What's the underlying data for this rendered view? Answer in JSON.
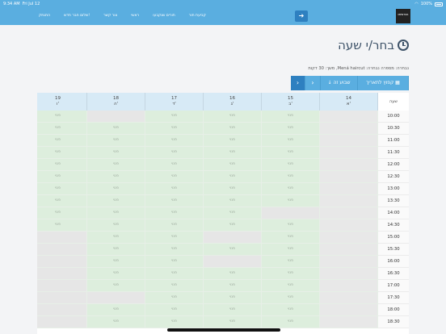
{
  "status": {
    "time": "9:34 AM",
    "date": "Fri Jul 12",
    "battery": "100%"
  },
  "nav": {
    "links": [
      "התנתק",
      "שלום חבר חדש!",
      "צור קשר",
      "ראשי",
      "תורים שנקבעו",
      "קביעת תור"
    ]
  },
  "logo": {
    "text": "MENTOR"
  },
  "page": {
    "title": "בחר/י שעה"
  },
  "selection": {
    "text": "נבחרה: מספרה נבחרה: Mená haircut, משך: 30 דקות"
  },
  "week_controls": {
    "jump_label": "קפוץ לתאריך",
    "this_week_label": "שבוע זה",
    "next_arrow": "›",
    "prev_arrow": "›"
  },
  "schedule": {
    "hour_header": "שעה",
    "free_label": "פנוי",
    "days": [
      {
        "num": "14",
        "abbr": "א'"
      },
      {
        "num": "15",
        "abbr": "ב'"
      },
      {
        "num": "16",
        "abbr": "ג'"
      },
      {
        "num": "17",
        "abbr": "ד'"
      },
      {
        "num": "18",
        "abbr": "ה'"
      },
      {
        "num": "19",
        "abbr": "ו'"
      }
    ],
    "hours": [
      "10:00",
      "10:30",
      "11:00",
      "11:30",
      "12:00",
      "12:30",
      "13:00",
      "13:30",
      "14:00",
      "14:30",
      "15:00",
      "15:30",
      "16:00",
      "16:30",
      "17:00",
      "17:30",
      "18:00",
      "18:30"
    ],
    "status": [
      [
        "c",
        "f",
        "f",
        "f",
        "b",
        "f"
      ],
      [
        "c",
        "f",
        "f",
        "f",
        "f",
        "f"
      ],
      [
        "c",
        "f",
        "f",
        "f",
        "f",
        "f"
      ],
      [
        "c",
        "f",
        "f",
        "f",
        "f",
        "f"
      ],
      [
        "c",
        "f",
        "f",
        "f",
        "f",
        "f"
      ],
      [
        "c",
        "f",
        "f",
        "f",
        "f",
        "f"
      ],
      [
        "c",
        "f",
        "f",
        "f",
        "f",
        "f"
      ],
      [
        "c",
        "f",
        "f",
        "f",
        "f",
        "f"
      ],
      [
        "c",
        "b",
        "f",
        "f",
        "f",
        "f"
      ],
      [
        "c",
        "f",
        "f",
        "f",
        "f",
        "f"
      ],
      [
        "c",
        "f",
        "b",
        "f",
        "f",
        "b"
      ],
      [
        "c",
        "f",
        "f",
        "f",
        "f",
        "b"
      ],
      [
        "c",
        "f",
        "b",
        "f",
        "f",
        "b"
      ],
      [
        "c",
        "f",
        "f",
        "f",
        "f",
        "b"
      ],
      [
        "c",
        "f",
        "f",
        "f",
        "f",
        "b"
      ],
      [
        "c",
        "f",
        "f",
        "f",
        "b",
        "b"
      ],
      [
        "c",
        "f",
        "f",
        "f",
        "f",
        "b"
      ],
      [
        "c",
        "f",
        "f",
        "f",
        "f",
        "b"
      ]
    ]
  }
}
